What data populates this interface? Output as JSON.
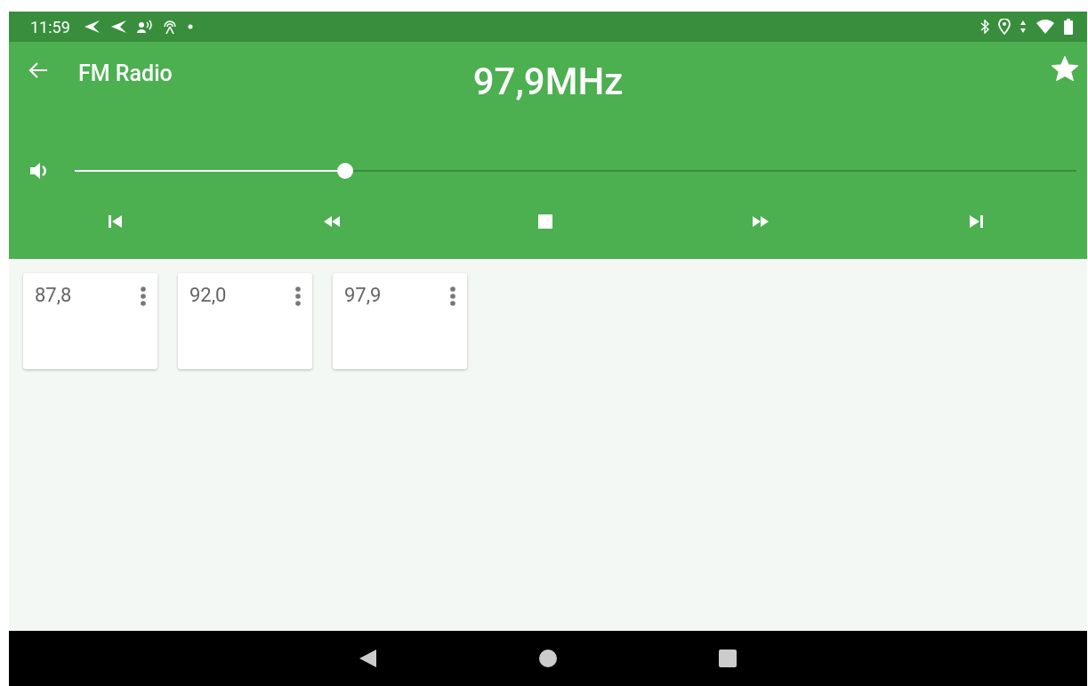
{
  "status_bar": {
    "time": "11:59"
  },
  "app_bar": {
    "title": "FM Radio",
    "frequency": "97,9MHz",
    "favorite": true
  },
  "volume": {
    "level": 0.27
  },
  "controls": [
    {
      "kind": "prev"
    },
    {
      "kind": "rewind"
    },
    {
      "kind": "stop"
    },
    {
      "kind": "forward"
    },
    {
      "kind": "next"
    }
  ],
  "presets": [
    {
      "frequency": "87,8"
    },
    {
      "frequency": "92,0"
    },
    {
      "frequency": "97,9"
    }
  ]
}
